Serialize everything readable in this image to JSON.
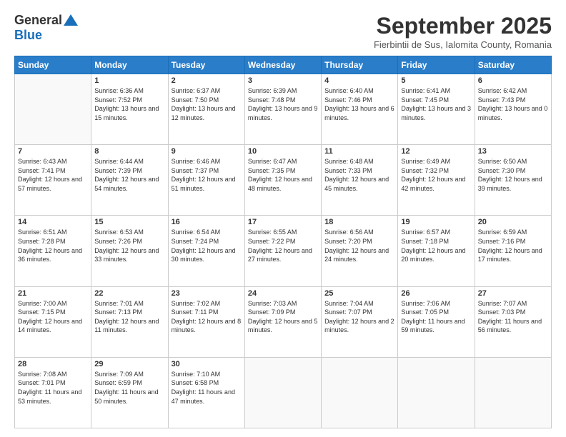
{
  "header": {
    "logo_general": "General",
    "logo_blue": "Blue",
    "month_title": "September 2025",
    "subtitle": "Fierbintii de Sus, Ialomita County, Romania"
  },
  "days_of_week": [
    "Sunday",
    "Monday",
    "Tuesday",
    "Wednesday",
    "Thursday",
    "Friday",
    "Saturday"
  ],
  "weeks": [
    [
      {
        "day": "",
        "sunrise": "",
        "sunset": "",
        "daylight": ""
      },
      {
        "day": "1",
        "sunrise": "Sunrise: 6:36 AM",
        "sunset": "Sunset: 7:52 PM",
        "daylight": "Daylight: 13 hours and 15 minutes."
      },
      {
        "day": "2",
        "sunrise": "Sunrise: 6:37 AM",
        "sunset": "Sunset: 7:50 PM",
        "daylight": "Daylight: 13 hours and 12 minutes."
      },
      {
        "day": "3",
        "sunrise": "Sunrise: 6:39 AM",
        "sunset": "Sunset: 7:48 PM",
        "daylight": "Daylight: 13 hours and 9 minutes."
      },
      {
        "day": "4",
        "sunrise": "Sunrise: 6:40 AM",
        "sunset": "Sunset: 7:46 PM",
        "daylight": "Daylight: 13 hours and 6 minutes."
      },
      {
        "day": "5",
        "sunrise": "Sunrise: 6:41 AM",
        "sunset": "Sunset: 7:45 PM",
        "daylight": "Daylight: 13 hours and 3 minutes."
      },
      {
        "day": "6",
        "sunrise": "Sunrise: 6:42 AM",
        "sunset": "Sunset: 7:43 PM",
        "daylight": "Daylight: 13 hours and 0 minutes."
      }
    ],
    [
      {
        "day": "7",
        "sunrise": "Sunrise: 6:43 AM",
        "sunset": "Sunset: 7:41 PM",
        "daylight": "Daylight: 12 hours and 57 minutes."
      },
      {
        "day": "8",
        "sunrise": "Sunrise: 6:44 AM",
        "sunset": "Sunset: 7:39 PM",
        "daylight": "Daylight: 12 hours and 54 minutes."
      },
      {
        "day": "9",
        "sunrise": "Sunrise: 6:46 AM",
        "sunset": "Sunset: 7:37 PM",
        "daylight": "Daylight: 12 hours and 51 minutes."
      },
      {
        "day": "10",
        "sunrise": "Sunrise: 6:47 AM",
        "sunset": "Sunset: 7:35 PM",
        "daylight": "Daylight: 12 hours and 48 minutes."
      },
      {
        "day": "11",
        "sunrise": "Sunrise: 6:48 AM",
        "sunset": "Sunset: 7:33 PM",
        "daylight": "Daylight: 12 hours and 45 minutes."
      },
      {
        "day": "12",
        "sunrise": "Sunrise: 6:49 AM",
        "sunset": "Sunset: 7:32 PM",
        "daylight": "Daylight: 12 hours and 42 minutes."
      },
      {
        "day": "13",
        "sunrise": "Sunrise: 6:50 AM",
        "sunset": "Sunset: 7:30 PM",
        "daylight": "Daylight: 12 hours and 39 minutes."
      }
    ],
    [
      {
        "day": "14",
        "sunrise": "Sunrise: 6:51 AM",
        "sunset": "Sunset: 7:28 PM",
        "daylight": "Daylight: 12 hours and 36 minutes."
      },
      {
        "day": "15",
        "sunrise": "Sunrise: 6:53 AM",
        "sunset": "Sunset: 7:26 PM",
        "daylight": "Daylight: 12 hours and 33 minutes."
      },
      {
        "day": "16",
        "sunrise": "Sunrise: 6:54 AM",
        "sunset": "Sunset: 7:24 PM",
        "daylight": "Daylight: 12 hours and 30 minutes."
      },
      {
        "day": "17",
        "sunrise": "Sunrise: 6:55 AM",
        "sunset": "Sunset: 7:22 PM",
        "daylight": "Daylight: 12 hours and 27 minutes."
      },
      {
        "day": "18",
        "sunrise": "Sunrise: 6:56 AM",
        "sunset": "Sunset: 7:20 PM",
        "daylight": "Daylight: 12 hours and 24 minutes."
      },
      {
        "day": "19",
        "sunrise": "Sunrise: 6:57 AM",
        "sunset": "Sunset: 7:18 PM",
        "daylight": "Daylight: 12 hours and 20 minutes."
      },
      {
        "day": "20",
        "sunrise": "Sunrise: 6:59 AM",
        "sunset": "Sunset: 7:16 PM",
        "daylight": "Daylight: 12 hours and 17 minutes."
      }
    ],
    [
      {
        "day": "21",
        "sunrise": "Sunrise: 7:00 AM",
        "sunset": "Sunset: 7:15 PM",
        "daylight": "Daylight: 12 hours and 14 minutes."
      },
      {
        "day": "22",
        "sunrise": "Sunrise: 7:01 AM",
        "sunset": "Sunset: 7:13 PM",
        "daylight": "Daylight: 12 hours and 11 minutes."
      },
      {
        "day": "23",
        "sunrise": "Sunrise: 7:02 AM",
        "sunset": "Sunset: 7:11 PM",
        "daylight": "Daylight: 12 hours and 8 minutes."
      },
      {
        "day": "24",
        "sunrise": "Sunrise: 7:03 AM",
        "sunset": "Sunset: 7:09 PM",
        "daylight": "Daylight: 12 hours and 5 minutes."
      },
      {
        "day": "25",
        "sunrise": "Sunrise: 7:04 AM",
        "sunset": "Sunset: 7:07 PM",
        "daylight": "Daylight: 12 hours and 2 minutes."
      },
      {
        "day": "26",
        "sunrise": "Sunrise: 7:06 AM",
        "sunset": "Sunset: 7:05 PM",
        "daylight": "Daylight: 11 hours and 59 minutes."
      },
      {
        "day": "27",
        "sunrise": "Sunrise: 7:07 AM",
        "sunset": "Sunset: 7:03 PM",
        "daylight": "Daylight: 11 hours and 56 minutes."
      }
    ],
    [
      {
        "day": "28",
        "sunrise": "Sunrise: 7:08 AM",
        "sunset": "Sunset: 7:01 PM",
        "daylight": "Daylight: 11 hours and 53 minutes."
      },
      {
        "day": "29",
        "sunrise": "Sunrise: 7:09 AM",
        "sunset": "Sunset: 6:59 PM",
        "daylight": "Daylight: 11 hours and 50 minutes."
      },
      {
        "day": "30",
        "sunrise": "Sunrise: 7:10 AM",
        "sunset": "Sunset: 6:58 PM",
        "daylight": "Daylight: 11 hours and 47 minutes."
      },
      {
        "day": "",
        "sunrise": "",
        "sunset": "",
        "daylight": ""
      },
      {
        "day": "",
        "sunrise": "",
        "sunset": "",
        "daylight": ""
      },
      {
        "day": "",
        "sunrise": "",
        "sunset": "",
        "daylight": ""
      },
      {
        "day": "",
        "sunrise": "",
        "sunset": "",
        "daylight": ""
      }
    ]
  ]
}
